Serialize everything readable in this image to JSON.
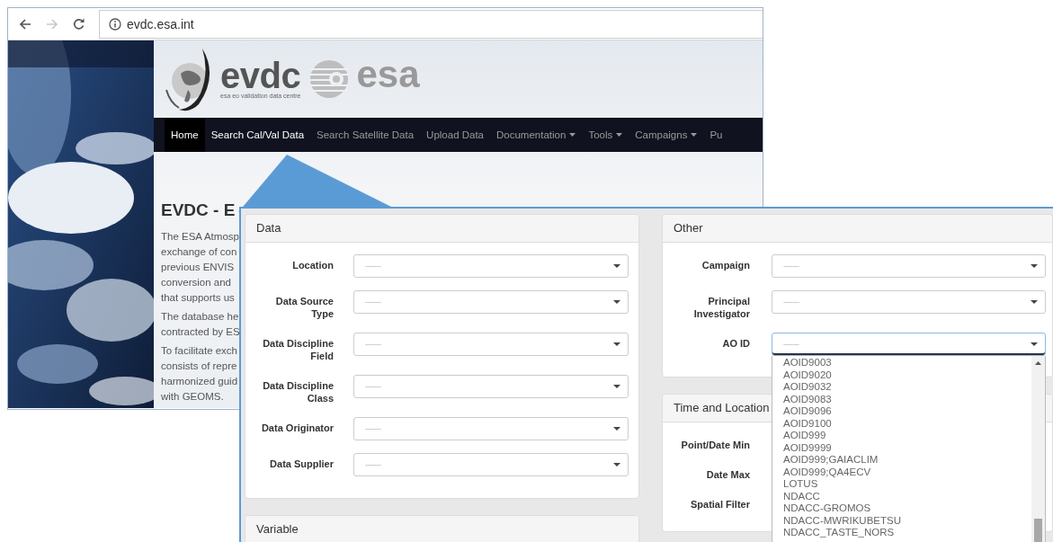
{
  "browser": {
    "nav_buttons": [
      {
        "kind": "back",
        "disabled": false
      },
      {
        "kind": "forward",
        "disabled": true
      },
      {
        "kind": "reload",
        "disabled": false
      }
    ],
    "url": "evdc.esa.int"
  },
  "site": {
    "logo": {
      "name": "evdc",
      "tagline": "esa eo validation data centre",
      "partner": "esa"
    },
    "menu": [
      {
        "label": "Home",
        "selected": true,
        "highlighted": false,
        "dropdown": false
      },
      {
        "label": "Search Cal/Val Data",
        "selected": false,
        "highlighted": true,
        "dropdown": false
      },
      {
        "label": "Search Satellite Data",
        "selected": false,
        "highlighted": false,
        "dropdown": false
      },
      {
        "label": "Upload Data",
        "selected": false,
        "highlighted": false,
        "dropdown": false
      },
      {
        "label": "Documentation",
        "selected": false,
        "highlighted": false,
        "dropdown": true
      },
      {
        "label": "Tools",
        "selected": false,
        "highlighted": false,
        "dropdown": true
      },
      {
        "label": "Campaigns",
        "selected": false,
        "highlighted": false,
        "dropdown": true
      },
      {
        "label": "Pu",
        "selected": false,
        "highlighted": false,
        "dropdown": false
      }
    ],
    "heading": "EVDC - E",
    "paragraphs": [
      [
        "The ESA Atmosp",
        "exchange of con",
        "previous ENVIS",
        "conversion and",
        "that supports us"
      ],
      [
        "The database he",
        "contracted by ES"
      ],
      [
        "To facilitate exch",
        "consists of repre",
        "harmonized guid",
        "with GEOMS."
      ]
    ]
  },
  "panel": {
    "columns": [
      [
        {
          "title": "Data",
          "fields": [
            {
              "label": "Location",
              "value": "-------",
              "open": false
            },
            {
              "label": "Data Source Type",
              "value": "-------",
              "open": false
            },
            {
              "label": "Data Discipline Field",
              "value": "-------",
              "open": false
            },
            {
              "label": "Data Discipline Class",
              "value": "-------",
              "open": false
            },
            {
              "label": "Data Originator",
              "value": "-------",
              "open": false
            },
            {
              "label": "Data Supplier",
              "value": "-------",
              "open": false
            }
          ]
        },
        {
          "title": "Variable"
        }
      ],
      [
        {
          "title": "Other",
          "fields": [
            {
              "label": "Campaign",
              "value": "-------",
              "open": false
            },
            {
              "label": "Principal Investigator",
              "value": "-------",
              "open": false
            },
            {
              "label": "AO ID",
              "value": "-------",
              "open": true,
              "options": [
                "AOID9003",
                "AOID9020",
                "AOID9032",
                "AOID9083",
                "AOID9096",
                "AOID9100",
                "AOID999",
                "AOID9999",
                "AOID999;GAIACLIM",
                "AOID999;QA4ECV",
                "LOTUS",
                "NDACC",
                "NDACC-GROMOS",
                "NDACC-MWRIKUBETSU",
                "NDACC_TASTE_NORS"
              ]
            }
          ]
        },
        {
          "title": "Time and Location",
          "fields": [
            {
              "label": "Point/Date Min"
            },
            {
              "label": "Date Max"
            },
            {
              "label": "Spatial Filter"
            }
          ]
        }
      ]
    ]
  }
}
